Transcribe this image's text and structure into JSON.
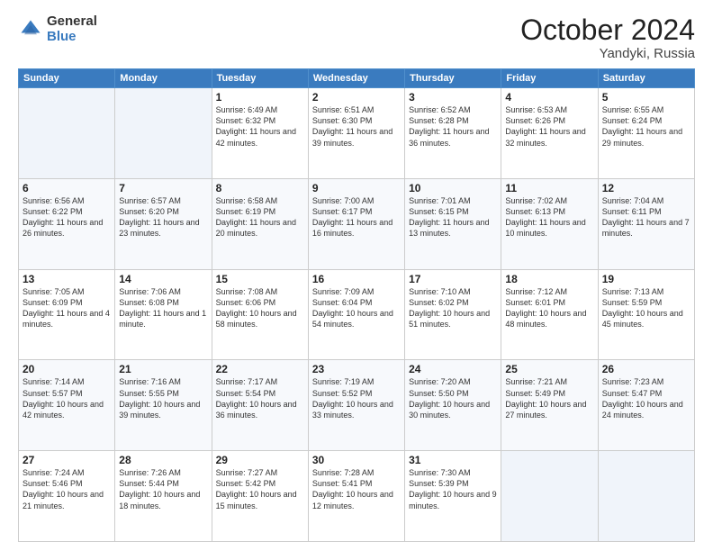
{
  "header": {
    "logo_general": "General",
    "logo_blue": "Blue",
    "month": "October 2024",
    "location": "Yandyki, Russia"
  },
  "days_of_week": [
    "Sunday",
    "Monday",
    "Tuesday",
    "Wednesday",
    "Thursday",
    "Friday",
    "Saturday"
  ],
  "weeks": [
    [
      {
        "day": "",
        "info": ""
      },
      {
        "day": "",
        "info": ""
      },
      {
        "day": "1",
        "info": "Sunrise: 6:49 AM\nSunset: 6:32 PM\nDaylight: 11 hours and 42 minutes."
      },
      {
        "day": "2",
        "info": "Sunrise: 6:51 AM\nSunset: 6:30 PM\nDaylight: 11 hours and 39 minutes."
      },
      {
        "day": "3",
        "info": "Sunrise: 6:52 AM\nSunset: 6:28 PM\nDaylight: 11 hours and 36 minutes."
      },
      {
        "day": "4",
        "info": "Sunrise: 6:53 AM\nSunset: 6:26 PM\nDaylight: 11 hours and 32 minutes."
      },
      {
        "day": "5",
        "info": "Sunrise: 6:55 AM\nSunset: 6:24 PM\nDaylight: 11 hours and 29 minutes."
      }
    ],
    [
      {
        "day": "6",
        "info": "Sunrise: 6:56 AM\nSunset: 6:22 PM\nDaylight: 11 hours and 26 minutes."
      },
      {
        "day": "7",
        "info": "Sunrise: 6:57 AM\nSunset: 6:20 PM\nDaylight: 11 hours and 23 minutes."
      },
      {
        "day": "8",
        "info": "Sunrise: 6:58 AM\nSunset: 6:19 PM\nDaylight: 11 hours and 20 minutes."
      },
      {
        "day": "9",
        "info": "Sunrise: 7:00 AM\nSunset: 6:17 PM\nDaylight: 11 hours and 16 minutes."
      },
      {
        "day": "10",
        "info": "Sunrise: 7:01 AM\nSunset: 6:15 PM\nDaylight: 11 hours and 13 minutes."
      },
      {
        "day": "11",
        "info": "Sunrise: 7:02 AM\nSunset: 6:13 PM\nDaylight: 11 hours and 10 minutes."
      },
      {
        "day": "12",
        "info": "Sunrise: 7:04 AM\nSunset: 6:11 PM\nDaylight: 11 hours and 7 minutes."
      }
    ],
    [
      {
        "day": "13",
        "info": "Sunrise: 7:05 AM\nSunset: 6:09 PM\nDaylight: 11 hours and 4 minutes."
      },
      {
        "day": "14",
        "info": "Sunrise: 7:06 AM\nSunset: 6:08 PM\nDaylight: 11 hours and 1 minute."
      },
      {
        "day": "15",
        "info": "Sunrise: 7:08 AM\nSunset: 6:06 PM\nDaylight: 10 hours and 58 minutes."
      },
      {
        "day": "16",
        "info": "Sunrise: 7:09 AM\nSunset: 6:04 PM\nDaylight: 10 hours and 54 minutes."
      },
      {
        "day": "17",
        "info": "Sunrise: 7:10 AM\nSunset: 6:02 PM\nDaylight: 10 hours and 51 minutes."
      },
      {
        "day": "18",
        "info": "Sunrise: 7:12 AM\nSunset: 6:01 PM\nDaylight: 10 hours and 48 minutes."
      },
      {
        "day": "19",
        "info": "Sunrise: 7:13 AM\nSunset: 5:59 PM\nDaylight: 10 hours and 45 minutes."
      }
    ],
    [
      {
        "day": "20",
        "info": "Sunrise: 7:14 AM\nSunset: 5:57 PM\nDaylight: 10 hours and 42 minutes."
      },
      {
        "day": "21",
        "info": "Sunrise: 7:16 AM\nSunset: 5:55 PM\nDaylight: 10 hours and 39 minutes."
      },
      {
        "day": "22",
        "info": "Sunrise: 7:17 AM\nSunset: 5:54 PM\nDaylight: 10 hours and 36 minutes."
      },
      {
        "day": "23",
        "info": "Sunrise: 7:19 AM\nSunset: 5:52 PM\nDaylight: 10 hours and 33 minutes."
      },
      {
        "day": "24",
        "info": "Sunrise: 7:20 AM\nSunset: 5:50 PM\nDaylight: 10 hours and 30 minutes."
      },
      {
        "day": "25",
        "info": "Sunrise: 7:21 AM\nSunset: 5:49 PM\nDaylight: 10 hours and 27 minutes."
      },
      {
        "day": "26",
        "info": "Sunrise: 7:23 AM\nSunset: 5:47 PM\nDaylight: 10 hours and 24 minutes."
      }
    ],
    [
      {
        "day": "27",
        "info": "Sunrise: 7:24 AM\nSunset: 5:46 PM\nDaylight: 10 hours and 21 minutes."
      },
      {
        "day": "28",
        "info": "Sunrise: 7:26 AM\nSunset: 5:44 PM\nDaylight: 10 hours and 18 minutes."
      },
      {
        "day": "29",
        "info": "Sunrise: 7:27 AM\nSunset: 5:42 PM\nDaylight: 10 hours and 15 minutes."
      },
      {
        "day": "30",
        "info": "Sunrise: 7:28 AM\nSunset: 5:41 PM\nDaylight: 10 hours and 12 minutes."
      },
      {
        "day": "31",
        "info": "Sunrise: 7:30 AM\nSunset: 5:39 PM\nDaylight: 10 hours and 9 minutes."
      },
      {
        "day": "",
        "info": ""
      },
      {
        "day": "",
        "info": ""
      }
    ]
  ]
}
